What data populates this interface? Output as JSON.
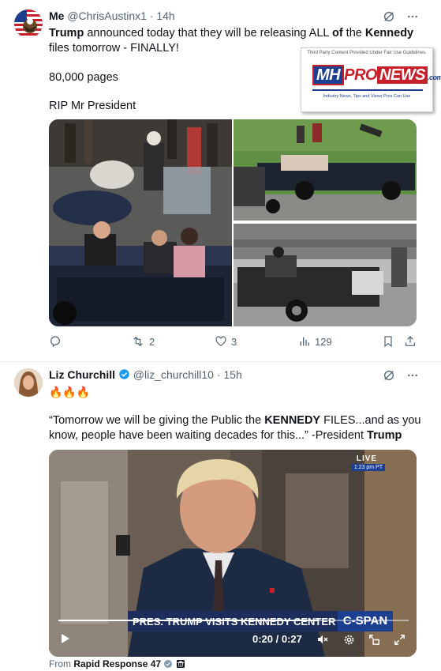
{
  "tweet1": {
    "display_name": "Me",
    "handle": "@ChrisAustinx1",
    "time": "· 14h",
    "text_parts": {
      "p1": "Trump",
      "p2": " announced today that they will be releasing ALL ",
      "p3": "of",
      "p4": " the ",
      "p5": "Kennedy",
      "p6": "files tomorrow - FINALLY!"
    },
    "line2": "80,000 pages",
    "line3": "RIP Mr President",
    "actions": {
      "replies": "",
      "reposts": "2",
      "likes": "3",
      "views": "129"
    }
  },
  "watermark": {
    "fair_use": "Third Party Content Provided Under Fair Use Guidelines.",
    "logo_mh": "MH",
    "logo_pro": "PRO",
    "logo_news": "NEWS",
    "logo_com": ".com",
    "tagline": "Industry News, Tips and Views Pros Can Use"
  },
  "tweet2": {
    "display_name": "Liz Churchill",
    "handle": "@liz_churchill10",
    "time": "· 15h",
    "emoji": "🔥🔥🔥",
    "quote_parts": {
      "q1": "“Tomorrow we will be giving the Public the ",
      "q2": "KENNEDY",
      "q3": " FILES...and as you",
      "q4": "know, people have been waiting decades for this...” -President ",
      "q5": "Trump"
    },
    "video": {
      "live_label": "LIVE",
      "live_time": "1:23 pm PT",
      "lower_third": "PRES. TRUMP VISITS KENNEDY CENTER",
      "network": "C-SPAN",
      "time_display": "0:20 / 0:27",
      "progress_fraction": 0.74
    },
    "from_label": "From",
    "from_source": "Rapid Response 47"
  },
  "colors": {
    "muted": "#536471",
    "verified": "#1d9bf0",
    "text": "#0f1419"
  }
}
